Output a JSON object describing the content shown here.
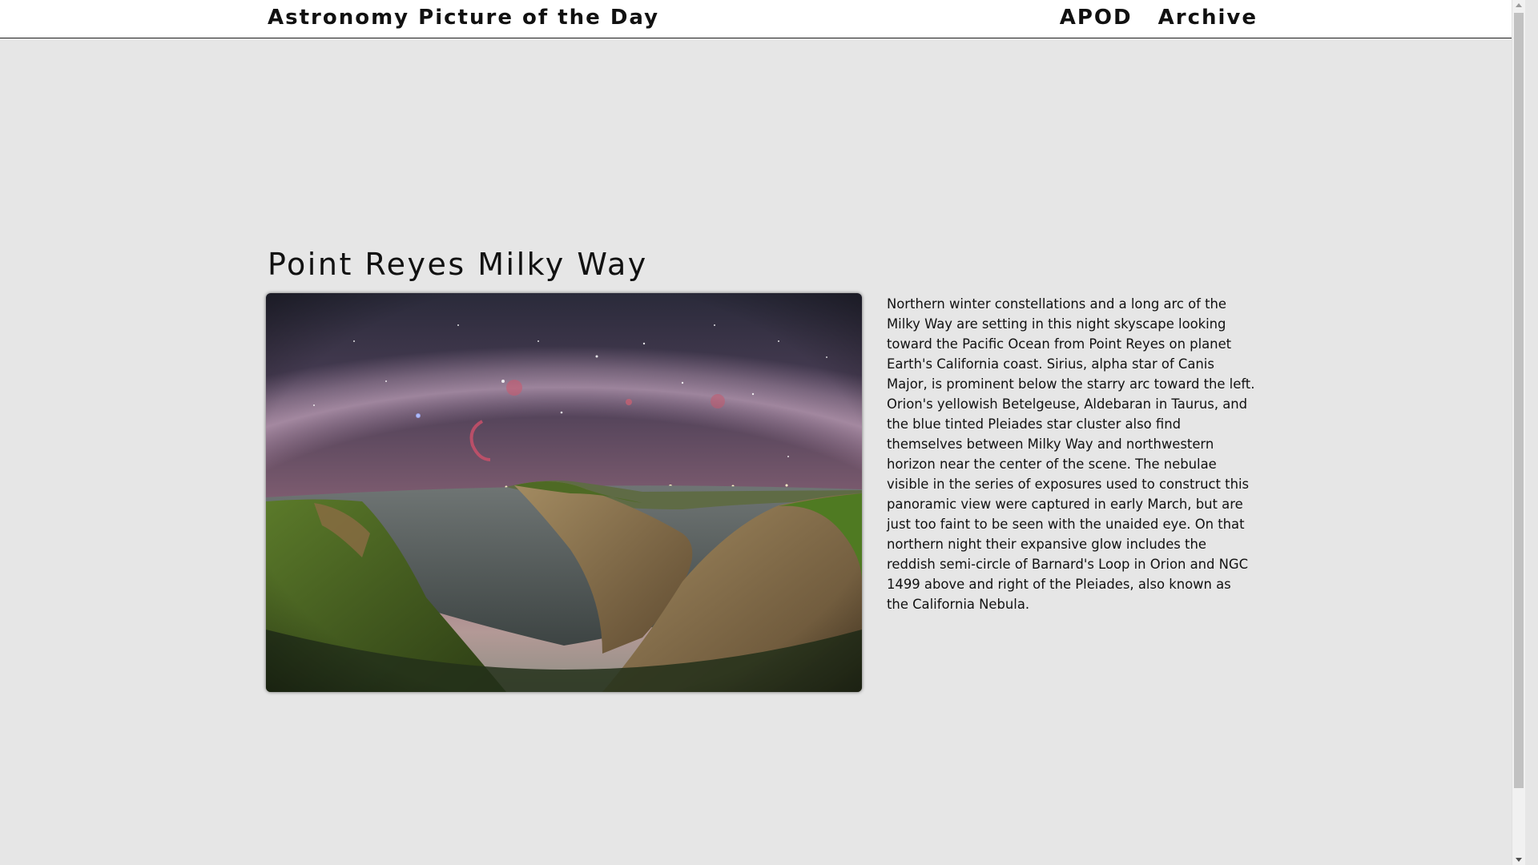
{
  "header": {
    "site_title": "Astronomy Picture of the Day",
    "nav": [
      {
        "label": "APOD"
      },
      {
        "label": "Archive"
      }
    ]
  },
  "main": {
    "title": "Point Reyes Milky Way",
    "image_alt": "Point Reyes Milky Way",
    "explanation": "Northern winter constellations and a long arc of the Milky Way are setting in this night skyscape looking toward the Pacific Ocean from Point Reyes on planet Earth's California coast. Sirius, alpha star of Canis Major, is prominent below the starry arc toward the left. Orion's yellowish Betelgeuse, Aldebaran in Taurus, and the blue tinted Pleiades star cluster also find themselves between Milky Way and northwestern horizon near the center of the scene. The nebulae visible in the series of exposures used to construct this panoramic view were captured in early March, but are just too faint to be seen with the unaided eye. On that northern night their expansive glow includes the reddish semi-circle of Barnard's Loop in Orion and NGC 1499 above and right of the Pleiades, also known as the California Nebula."
  },
  "colors": {
    "page_background": "#e6e6e6",
    "header_background": "#ffffff",
    "text": "#111111"
  }
}
